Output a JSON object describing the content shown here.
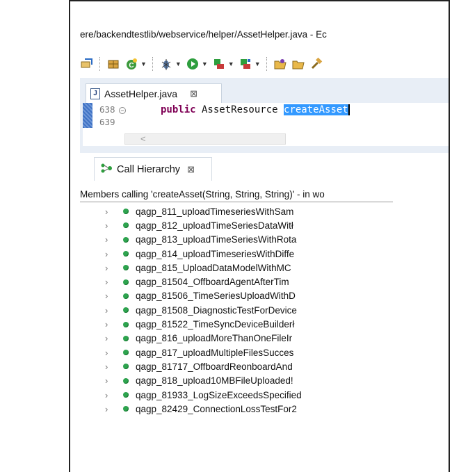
{
  "window": {
    "title": "ere/backendtestlib/webservice/helper/AssetHelper.java - Ec"
  },
  "toolbar": {
    "icons": [
      "refactor-icon",
      "package-icon",
      "new-class-icon",
      "debug-icon",
      "run-icon",
      "run-coverage-icon",
      "external-tools-icon",
      "open-folder-icon",
      "open-project-icon",
      "hammer-icon"
    ]
  },
  "editor": {
    "tab_label": "AssetHelper.java",
    "tab_close": "⊠",
    "lines": [
      {
        "number": "638",
        "fold": "⊖",
        "code_keyword": "public",
        "code_type": " AssetResource ",
        "code_selected": "createAsset"
      },
      {
        "number": "639"
      }
    ],
    "scroll_arrow": "<"
  },
  "call_hierarchy": {
    "tab_label": "Call Hierarchy",
    "tab_close": "⊠",
    "summary": "Members calling 'createAsset(String, String, String)' - in wo",
    "items": [
      "qagp_811_uploadTimeseriesWithSam",
      "qagp_812_uploadTimeSeriesDataWitł",
      "qagp_813_uploadTimeSeriesWithRotа",
      "qagp_814_uploadTimeseriesWithDiffe",
      "qagp_815_UploadDataModelWithMC",
      "qagp_81504_OffboardAgentAfterTim",
      "qagp_81506_TimeSeriesUploadWithD",
      "qagp_81508_DiagnosticTestForDevice",
      "qagp_81522_TimeSyncDeviceBuilderł",
      "qagp_816_uploadMoreThanOneFileIr",
      "qagp_817_uploadMultipleFilesSucces",
      "qagp_81717_OffboardReonboardAnd",
      "qagp_818_upload10MBFileUploaded!",
      "qagp_81933_LogSizeExceedsSpecified",
      "qagp_82429_ConnectionLossTestFor2"
    ],
    "colors": {
      "method_dot": "#2ea44f"
    }
  }
}
